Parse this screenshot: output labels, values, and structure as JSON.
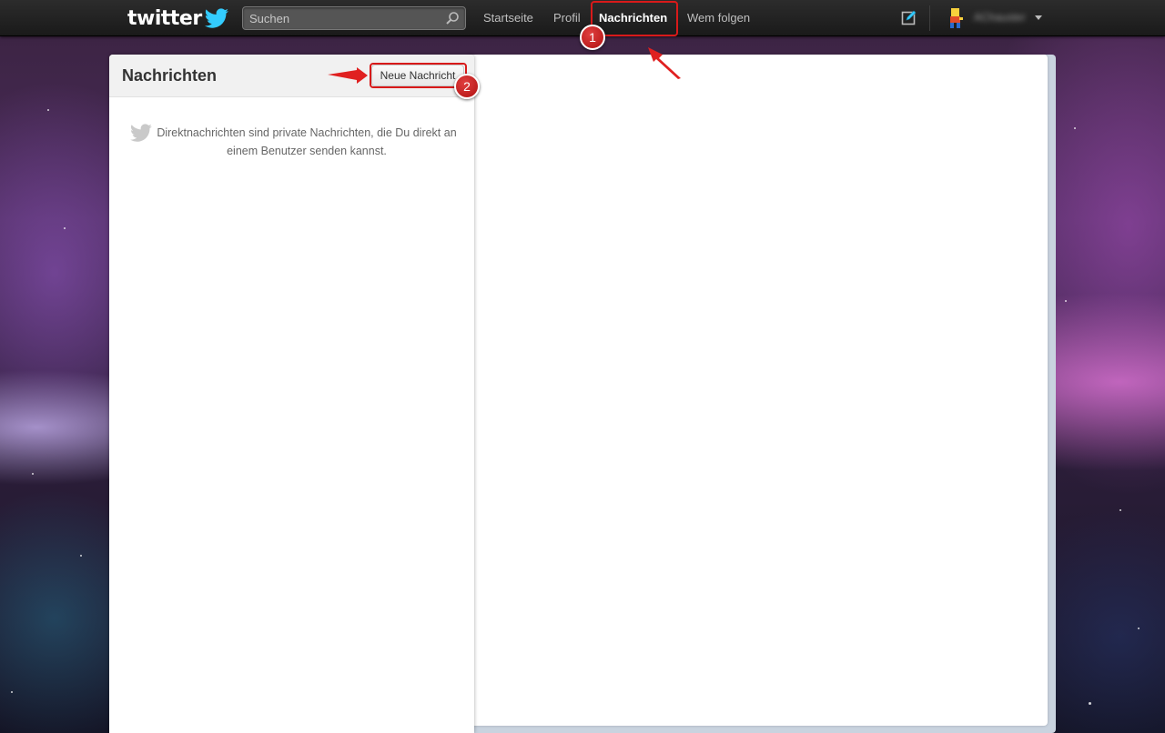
{
  "brand": {
    "logo_text": "twitter"
  },
  "search": {
    "placeholder": "Suchen"
  },
  "nav": {
    "items": [
      {
        "label": "Startseite"
      },
      {
        "label": "Profil"
      },
      {
        "label": "Nachrichten",
        "active": true
      },
      {
        "label": "Wem folgen"
      }
    ]
  },
  "user": {
    "name": "AChauster"
  },
  "messages_panel": {
    "title": "Nachrichten",
    "new_message_label": "Neue Nachricht",
    "empty_text": "Direktnachrichten sind private Nachrichten, die Du direkt an einem Benutzer senden kannst."
  },
  "annotations": {
    "step1": "1",
    "step2": "2",
    "color": "#d81a1a"
  },
  "colors": {
    "topbar": "#1f1f1f",
    "accent_blue": "#33ccff"
  }
}
